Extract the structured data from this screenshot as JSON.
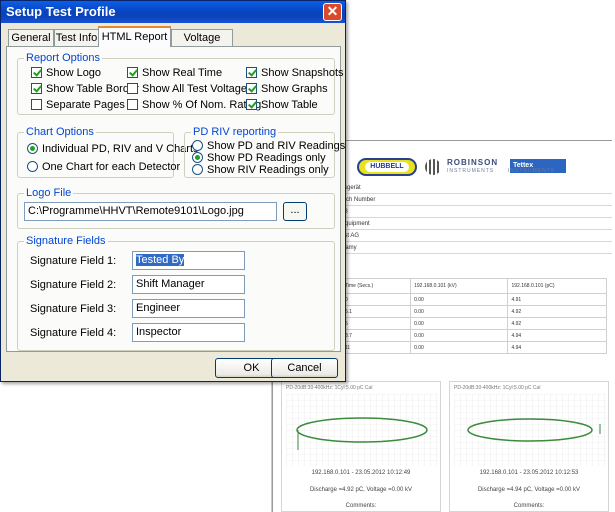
{
  "dialog": {
    "title": "Setup Test Profile",
    "close_glyph": "✕",
    "tabs": [
      {
        "label": "General"
      },
      {
        "label": "Test Info"
      },
      {
        "label": "HTML Report"
      },
      {
        "label": "Voltage Profile"
      }
    ],
    "active_tab": "HTML Report",
    "report_options": {
      "title": "Report Options",
      "items": [
        {
          "label": "Show Logo",
          "checked": true
        },
        {
          "label": "Show Real Time",
          "checked": true
        },
        {
          "label": "Show Snapshots",
          "checked": true
        },
        {
          "label": "Show Table Border",
          "checked": true
        },
        {
          "label": "Show All Test Voltages",
          "checked": false
        },
        {
          "label": "Show Graphs",
          "checked": true
        },
        {
          "label": "Separate Pages",
          "checked": false
        },
        {
          "label": "Show % Of Nom. Rating",
          "checked": false
        },
        {
          "label": "Show Table",
          "checked": true
        }
      ]
    },
    "chart_options": {
      "title": "Chart Options",
      "items": [
        {
          "label": "Individual PD, RIV and V Charts",
          "selected": true
        },
        {
          "label": "One Chart for each Detector",
          "selected": false
        }
      ]
    },
    "pd_riv": {
      "title": "PD RIV reporting",
      "items": [
        {
          "label": "Show PD and RIV Readings",
          "selected": false
        },
        {
          "label": "Show PD Readings only",
          "selected": true
        },
        {
          "label": "Show RIV Readings only",
          "selected": false
        }
      ]
    },
    "logo_file": {
      "title": "Logo File",
      "path": "C:\\Programme\\HHVT\\Remote9101\\Logo.jpg",
      "browse_label": "..."
    },
    "signature_fields": {
      "title": "Signature Fields",
      "fields": [
        {
          "label": "Signature Field 1:",
          "value": "Tested By"
        },
        {
          "label": "Signature Field 2:",
          "value": "Shift Manager"
        },
        {
          "label": "Signature Field 3:",
          "value": "Engineer"
        },
        {
          "label": "Signature Field 4:",
          "value": "Inspector"
        }
      ]
    },
    "ok_label": "OK",
    "cancel_label": "Cancel"
  },
  "report": {
    "logos": {
      "hubbell": "HUBBELL",
      "robinson": "ROBINSON",
      "robinson_sub": "INSTRUMENTS",
      "tettex": "Tettex",
      "tettex_sub": "INSTRUMENTS"
    },
    "info_rows": [
      "ssgerät",
      "atch Number",
      "88",
      "Equipment",
      "est AG",
      "wamy"
    ],
    "table": {
      "headers": [
        "Time (Secs.)",
        "192.168.0.101 (kV)",
        "192.168.0.101 (pC)"
      ],
      "rows": [
        [
          "0",
          "0.00",
          "4.91"
        ],
        [
          "5.1",
          "0.00",
          "4.92"
        ],
        [
          "5",
          "0.00",
          "4.92"
        ],
        [
          "8.7",
          "0.00",
          "4.94"
        ],
        [
          "11",
          "0.00",
          "4.94"
        ]
      ]
    },
    "graphs": [
      {
        "label": "PD-20dB:30-400kHz: 1Cyl:5.00 pC Cal",
        "caption": "192.168.0.101 - 23.05.2012 10:12:49",
        "discharge": "Discharge =4.92 pC, Voltage =0.00 kV",
        "comments": "Comments:"
      },
      {
        "label": "PD-20dB:30-400kHz: 1Cyl:5.00 pC Cal",
        "caption": "192.168.0.101 - 23.05.2012 10:12:53",
        "discharge": "Discharge =4.94 pC, Voltage =0.00 kV",
        "comments": "Comments:"
      }
    ]
  },
  "colors": {
    "group_title": "#0046d5",
    "titlebar": "#0845c2",
    "ellipse": "#3c8a3c",
    "tab_highlight": "#e68b2c"
  }
}
